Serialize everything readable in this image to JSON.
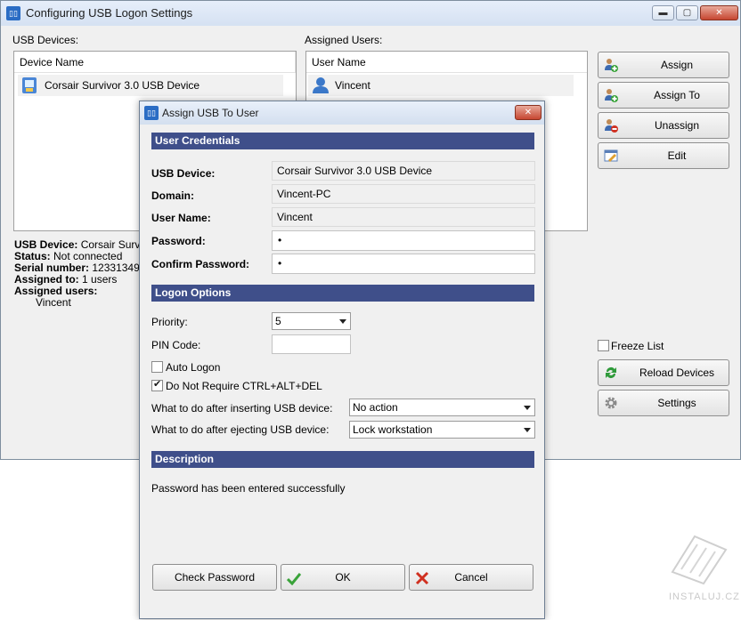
{
  "main": {
    "title": "Configuring USB Logon Settings",
    "usb_devices_label": "USB Devices:",
    "assigned_users_label": "Assigned Users:",
    "device_header": "Device Name",
    "device_row": "Corsair Survivor 3.0 USB Device",
    "user_header": "User Name",
    "user_row": "Vincent",
    "buttons": {
      "assign": "Assign",
      "assign_to": "Assign To",
      "unassign": "Unassign",
      "edit": "Edit",
      "reload": "Reload Devices",
      "settings": "Settings"
    },
    "freeze_list": "Freeze List",
    "info": {
      "device_label": "USB Device:",
      "device_value": "Corsair Survivo",
      "status_label": "Status:",
      "status_value": "Not connected",
      "serial_label": "Serial number:",
      "serial_value": "123313492",
      "assigned_to_label": "Assigned to:",
      "assigned_to_value": "1 users",
      "assigned_users_label": "Assigned users:",
      "assigned_users_value": "Vincent"
    },
    "window_buttons": {
      "minimize": "▬",
      "maximize": "▢",
      "close": "✕"
    }
  },
  "dialog": {
    "title": "Assign USB To User",
    "close": "✕",
    "credentials_header": "User Credentials",
    "usb_device_label": "USB Device:",
    "usb_device_value": "Corsair Survivor 3.0 USB Device",
    "domain_label": "Domain:",
    "domain_value": "Vincent-PC",
    "username_label": "User Name:",
    "username_value": "Vincent",
    "password_label": "Password:",
    "password_value": "•",
    "confirm_label": "Confirm Password:",
    "confirm_value": "•",
    "logon_header": "Logon Options",
    "priority_label": "Priority:",
    "priority_value": "5",
    "pin_label": "PIN Code:",
    "pin_value": "",
    "auto_logon": "Auto Logon",
    "no_ctrl": "Do Not Require CTRL+ALT+DEL",
    "after_insert_label": "What to do after inserting USB device:",
    "after_insert_value": "No action",
    "after_eject_label": "What to do after ejecting USB device:",
    "after_eject_value": "Lock workstation",
    "description_header": "Description",
    "description_text": "Password has been entered successfully",
    "check_password": "Check Password",
    "ok": "OK",
    "cancel": "Cancel"
  },
  "watermark": "INSTALUJ.CZ",
  "colors": {
    "section_header": "#3f4f8a",
    "ok_icon": "#3aa33a",
    "cancel_icon": "#d03020"
  }
}
